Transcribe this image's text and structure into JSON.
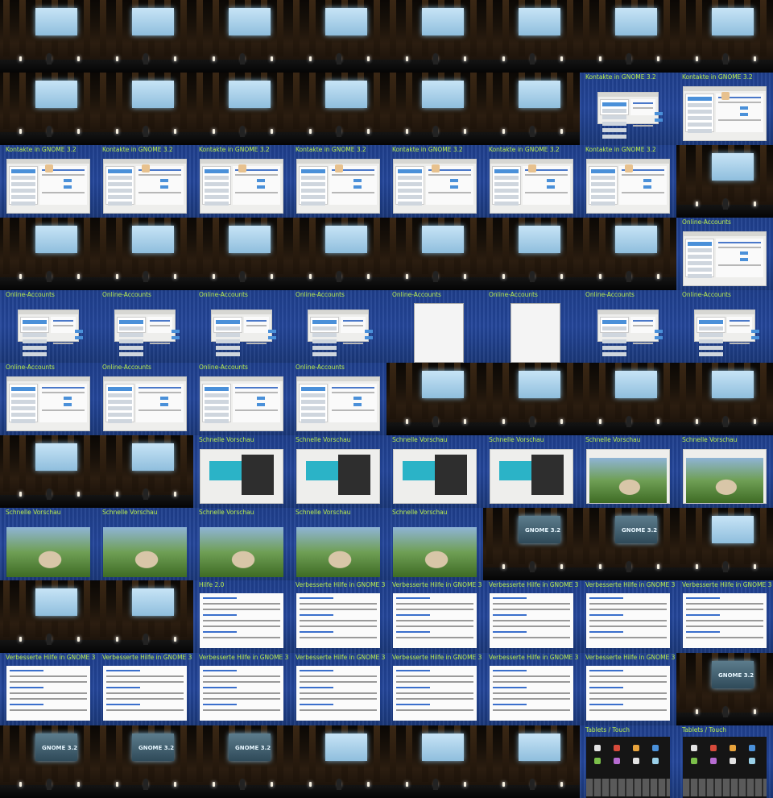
{
  "contact_sheet": {
    "columns": 8,
    "rows": 11,
    "tiles": [
      {
        "kind": "hall"
      },
      {
        "kind": "hall"
      },
      {
        "kind": "hall"
      },
      {
        "kind": "hall"
      },
      {
        "kind": "hall"
      },
      {
        "kind": "hall"
      },
      {
        "kind": "hall"
      },
      {
        "kind": "hall"
      },
      {
        "kind": "hall"
      },
      {
        "kind": "hall"
      },
      {
        "kind": "hall"
      },
      {
        "kind": "hall"
      },
      {
        "kind": "hall"
      },
      {
        "kind": "hall"
      },
      {
        "kind": "slide",
        "title": "Kontakte in GNOME 3.2",
        "layout": "win-small"
      },
      {
        "kind": "slide",
        "title": "Kontakte in GNOME 3.2",
        "layout": "win"
      },
      {
        "kind": "slide",
        "title": "Kontakte in GNOME 3.2",
        "layout": "win"
      },
      {
        "kind": "slide",
        "title": "Kontakte in GNOME 3.2",
        "layout": "win"
      },
      {
        "kind": "slide",
        "title": "Kontakte in GNOME 3.2",
        "layout": "win"
      },
      {
        "kind": "slide",
        "title": "Kontakte in GNOME 3.2",
        "layout": "win"
      },
      {
        "kind": "slide",
        "title": "Kontakte in GNOME 3.2",
        "layout": "win"
      },
      {
        "kind": "slide",
        "title": "Kontakte in GNOME 3.2",
        "layout": "win"
      },
      {
        "kind": "slide",
        "title": "Kontakte in GNOME 3.2",
        "layout": "win"
      },
      {
        "kind": "hall"
      },
      {
        "kind": "hall"
      },
      {
        "kind": "hall"
      },
      {
        "kind": "hall"
      },
      {
        "kind": "hall"
      },
      {
        "kind": "hall"
      },
      {
        "kind": "hall"
      },
      {
        "kind": "hall"
      },
      {
        "kind": "slide",
        "title": "Online-Accounts",
        "layout": "win"
      },
      {
        "kind": "slide",
        "title": "Online-Accounts",
        "layout": "win-small"
      },
      {
        "kind": "slide",
        "title": "Online-Accounts",
        "layout": "win-small"
      },
      {
        "kind": "slide",
        "title": "Online-Accounts",
        "layout": "win-small"
      },
      {
        "kind": "slide",
        "title": "Online-Accounts",
        "layout": "win-small"
      },
      {
        "kind": "slide",
        "title": "Online-Accounts",
        "layout": "google"
      },
      {
        "kind": "slide",
        "title": "Online-Accounts",
        "layout": "google"
      },
      {
        "kind": "slide",
        "title": "Online-Accounts",
        "layout": "win-small"
      },
      {
        "kind": "slide",
        "title": "Online-Accounts",
        "layout": "win-small"
      },
      {
        "kind": "slide",
        "title": "Online-Accounts",
        "layout": "win"
      },
      {
        "kind": "slide",
        "title": "Online-Accounts",
        "layout": "win"
      },
      {
        "kind": "slide",
        "title": "Online-Accounts",
        "layout": "win"
      },
      {
        "kind": "slide",
        "title": "Online-Accounts",
        "layout": "win"
      },
      {
        "kind": "hall"
      },
      {
        "kind": "hall"
      },
      {
        "kind": "hall"
      },
      {
        "kind": "hall"
      },
      {
        "kind": "hall"
      },
      {
        "kind": "hall"
      },
      {
        "kind": "slide",
        "title": "Schnelle Vorschau",
        "layout": "preview"
      },
      {
        "kind": "slide",
        "title": "Schnelle Vorschau",
        "layout": "preview"
      },
      {
        "kind": "slide",
        "title": "Schnelle Vorschau",
        "layout": "preview"
      },
      {
        "kind": "slide",
        "title": "Schnelle Vorschau",
        "layout": "preview"
      },
      {
        "kind": "slide",
        "title": "Schnelle Vorschau",
        "layout": "video"
      },
      {
        "kind": "slide",
        "title": "Schnelle Vorschau",
        "layout": "video"
      },
      {
        "kind": "slide",
        "title": "Schnelle Vorschau",
        "layout": "video-big"
      },
      {
        "kind": "slide",
        "title": "Schnelle Vorschau",
        "layout": "video-big"
      },
      {
        "kind": "slide",
        "title": "Schnelle Vorschau",
        "layout": "video-big"
      },
      {
        "kind": "slide",
        "title": "Schnelle Vorschau",
        "layout": "video-big"
      },
      {
        "kind": "slide",
        "title": "Schnelle Vorschau",
        "layout": "video-big"
      },
      {
        "kind": "hall",
        "screentext": "GNOME 3.2",
        "darkscreen": true
      },
      {
        "kind": "hall",
        "screentext": "GNOME 3.2",
        "darkscreen": true
      },
      {
        "kind": "hall"
      },
      {
        "kind": "hall"
      },
      {
        "kind": "hall"
      },
      {
        "kind": "slide",
        "title": "Hilfe 2.0",
        "layout": "doc"
      },
      {
        "kind": "slide",
        "title": "Verbesserte Hilfe in GNOME 3",
        "layout": "doc"
      },
      {
        "kind": "slide",
        "title": "Verbesserte Hilfe in GNOME 3",
        "layout": "doc"
      },
      {
        "kind": "slide",
        "title": "Verbesserte Hilfe in GNOME 3",
        "layout": "doc"
      },
      {
        "kind": "slide",
        "title": "Verbesserte Hilfe in GNOME 3",
        "layout": "doc"
      },
      {
        "kind": "slide",
        "title": "Verbesserte Hilfe in GNOME 3",
        "layout": "doc"
      },
      {
        "kind": "slide",
        "title": "Verbesserte Hilfe in GNOME 3",
        "layout": "doc"
      },
      {
        "kind": "slide",
        "title": "Verbesserte Hilfe in GNOME 3",
        "layout": "doc"
      },
      {
        "kind": "slide",
        "title": "Verbesserte Hilfe in GNOME 3",
        "layout": "doc"
      },
      {
        "kind": "slide",
        "title": "Verbesserte Hilfe in GNOME 3",
        "layout": "doc"
      },
      {
        "kind": "slide",
        "title": "Verbesserte Hilfe in GNOME 3",
        "layout": "doc"
      },
      {
        "kind": "slide",
        "title": "Verbesserte Hilfe in GNOME 3",
        "layout": "doc"
      },
      {
        "kind": "slide",
        "title": "Verbesserte Hilfe in GNOME 3",
        "layout": "doc"
      },
      {
        "kind": "hall",
        "screentext": "GNOME 3.2",
        "darkscreen": true
      },
      {
        "kind": "hall",
        "screentext": "GNOME 3.2",
        "darkscreen": true
      },
      {
        "kind": "hall",
        "screentext": "GNOME 3.2",
        "darkscreen": true
      },
      {
        "kind": "hall",
        "screentext": "GNOME 3.2",
        "darkscreen": true
      },
      {
        "kind": "hall"
      },
      {
        "kind": "hall"
      },
      {
        "kind": "hall"
      },
      {
        "kind": "slide",
        "title": "Tablets / Touch",
        "layout": "tablet"
      },
      {
        "kind": "slide",
        "title": "Tablets / Touch",
        "layout": "tablet"
      }
    ]
  }
}
